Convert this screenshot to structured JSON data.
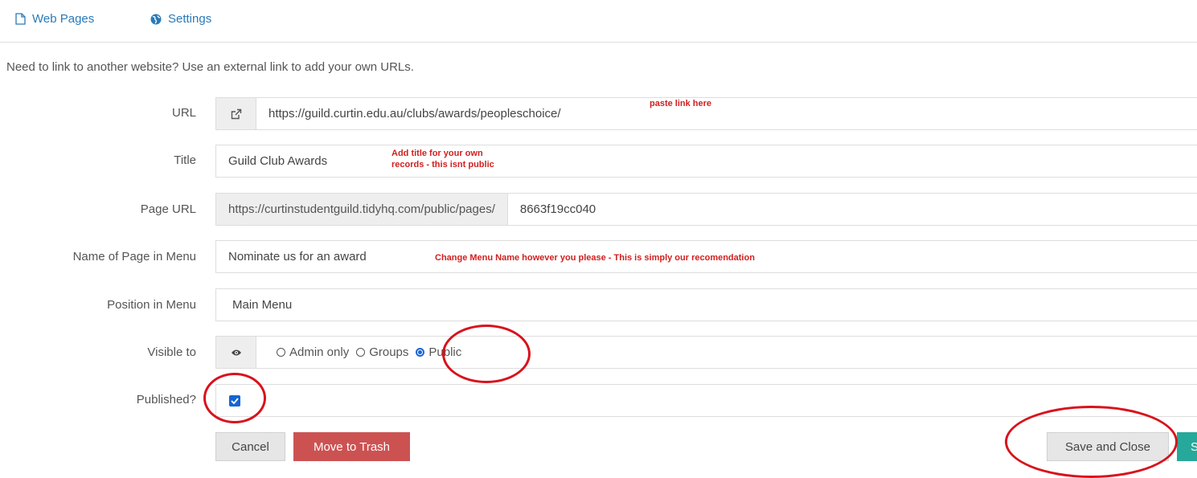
{
  "tabs": {
    "web_pages": "Web Pages",
    "settings": "Settings"
  },
  "intro": "Need to link to another website? Use an external link to add your own URLs.",
  "form": {
    "url": {
      "label": "URL",
      "value": "https://guild.curtin.edu.au/clubs/awards/peopleschoice/",
      "icon": "external-link-icon"
    },
    "title": {
      "label": "Title",
      "value": "Guild Club Awards"
    },
    "page_url": {
      "label": "Page URL",
      "prefix": "https://curtinstudentguild.tidyhq.com/public/pages/",
      "value": "8663f19cc040"
    },
    "menu_name": {
      "label": "Name of Page in Menu",
      "value": "Nominate us for an award"
    },
    "position": {
      "label": "Position in Menu",
      "value": "Main Menu"
    },
    "visible": {
      "label": "Visible to",
      "icon": "eye-icon",
      "options": [
        "Admin only",
        "Groups",
        "Public"
      ],
      "selected": "Public"
    },
    "published": {
      "label": "Published?",
      "checked": true
    }
  },
  "notes": {
    "url": "paste link here",
    "title_line1": "Add title for your own",
    "title_line2": "records - this isnt public",
    "menu_name": "Change Menu Name however you please - This is simply our recomendation"
  },
  "buttons": {
    "cancel": "Cancel",
    "trash": "Move to Trash",
    "save_close": "Save and Close",
    "save_partial": "S"
  },
  "colors": {
    "link": "#2a7ab8",
    "annotation": "#d11f1f",
    "trash": "#cc5252",
    "save": "#26a99a",
    "checkbox": "#1565d1"
  }
}
